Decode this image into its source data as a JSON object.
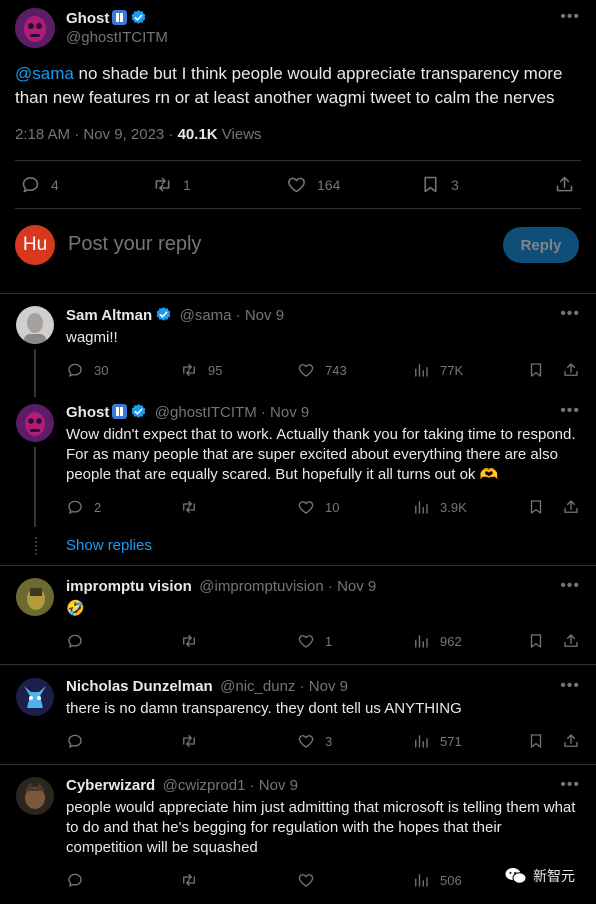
{
  "main_tweet": {
    "author": "Ghost",
    "handle": "@ghostITCITM",
    "mention": "@sama",
    "text": " no shade but I think people would appreciate transparency more than new features rn or at least another wagmi tweet to calm the nerves",
    "time": "2:18 AM · Nov 9, 2023 · ",
    "views": "40.1K",
    "views_label": " Views",
    "stats": {
      "replies": "4",
      "retweets": "1",
      "likes": "164",
      "bookmarks": "3"
    }
  },
  "reply_box": {
    "avatar_text": "Hu",
    "placeholder": "Post your reply",
    "button": "Reply"
  },
  "replies": [
    {
      "author": "Sam Altman",
      "handle": "@sama",
      "date": " · Nov 9",
      "text": "wagmi!!",
      "replies": "30",
      "retweets": "95",
      "likes": "743",
      "views": "77K"
    },
    {
      "author": "Ghost",
      "handle": "@ghostITCITM",
      "date": " · Nov 9",
      "text": "Wow didn't expect that to work. Actually thank you for taking time to respond. For as many people that are super excited about everything there are also people that are equally scared. But hopefully it all turns out ok 🫶",
      "replies": "2",
      "retweets": "",
      "likes": "10",
      "views": "3.9K"
    },
    {
      "author": "impromptu vision",
      "handle": "@impromptuvision",
      "date": " · Nov 9",
      "text": "🤣",
      "replies": "",
      "retweets": "",
      "likes": "1",
      "views": "962"
    },
    {
      "author": "Nicholas Dunzelman",
      "handle": "@nic_dunz",
      "date": " · Nov 9",
      "text": "there is no damn transparency. they dont tell us ANYTHING",
      "replies": "",
      "retweets": "",
      "likes": "3",
      "views": "571"
    },
    {
      "author": "Cyberwizard",
      "handle": "@cwizprod1",
      "date": " · Nov 9",
      "text": "people would appreciate him just admitting that microsoft is telling them what to do and that he's begging for regulation with the hopes that their competition will be squashed",
      "replies": "",
      "retweets": "",
      "likes": "",
      "views": "506"
    }
  ],
  "show_replies": "Show replies",
  "watermark": "新智元",
  "colors": {
    "accent": "#1d9bf0",
    "background": "#000000",
    "muted": "#71767b",
    "divider": "#2f3336"
  }
}
